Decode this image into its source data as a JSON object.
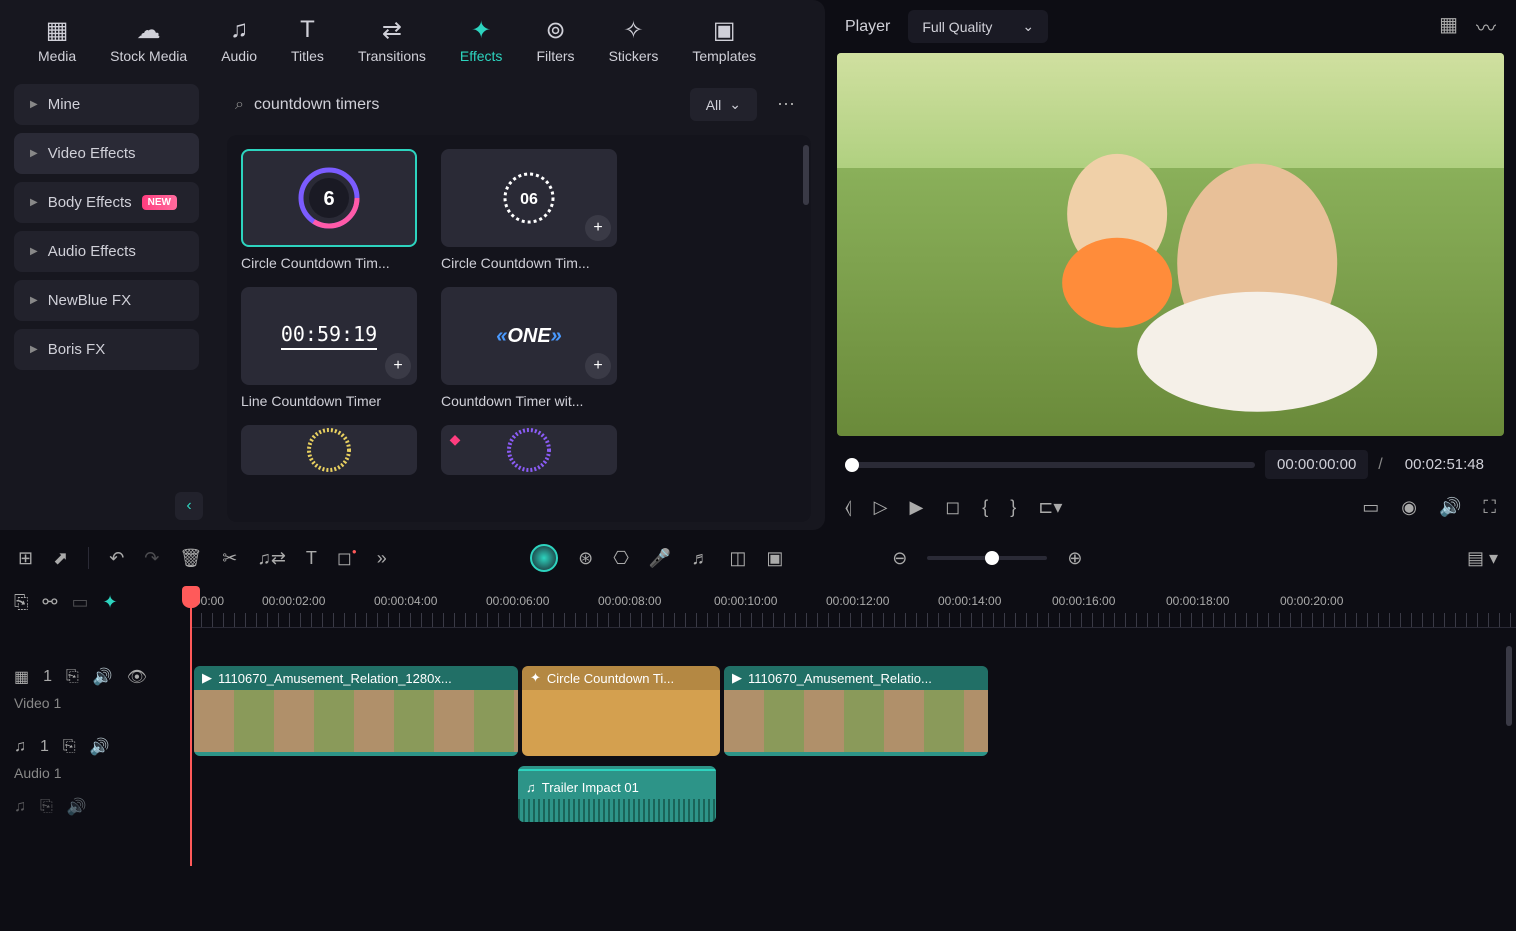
{
  "nav": {
    "tabs": [
      {
        "id": "media",
        "label": "Media"
      },
      {
        "id": "stock",
        "label": "Stock Media"
      },
      {
        "id": "audio",
        "label": "Audio"
      },
      {
        "id": "titles",
        "label": "Titles"
      },
      {
        "id": "transitions",
        "label": "Transitions"
      },
      {
        "id": "effects",
        "label": "Effects"
      },
      {
        "id": "filters",
        "label": "Filters"
      },
      {
        "id": "stickers",
        "label": "Stickers"
      },
      {
        "id": "templates",
        "label": "Templates"
      }
    ],
    "active": "effects"
  },
  "sidebar": {
    "items": [
      {
        "label": "Mine"
      },
      {
        "label": "Video Effects",
        "active": true
      },
      {
        "label": "Body Effects",
        "new": true
      },
      {
        "label": "Audio Effects"
      },
      {
        "label": "NewBlue FX"
      },
      {
        "label": "Boris FX"
      }
    ]
  },
  "search": {
    "value": "countdown timers",
    "filter": "All"
  },
  "effects": [
    {
      "label": "Circle Countdown Tim...",
      "selected": true,
      "number": "6"
    },
    {
      "label": "Circle Countdown Tim...",
      "number": "06"
    },
    {
      "label": "Line Countdown Timer",
      "time": "00:59:19"
    },
    {
      "label": "Countdown Timer wit...",
      "one": "ONE"
    }
  ],
  "player": {
    "title": "Player",
    "quality": "Full Quality",
    "current": "00:00:00:00",
    "duration": "00:02:51:48"
  },
  "ruler": {
    "ticks": [
      "00:00",
      "00:00:02:00",
      "00:00:04:00",
      "00:00:06:00",
      "00:00:08:00",
      "00:00:10:00",
      "00:00:12:00",
      "00:00:14:00",
      "00:00:16:00",
      "00:00:18:00",
      "00:00:20:00"
    ]
  },
  "tracks": {
    "video": {
      "num": "1",
      "label": "Video 1"
    },
    "audio": {
      "num": "1",
      "label": "Audio 1"
    }
  },
  "clips": {
    "v1": "1110670_Amusement_Relation_1280x...",
    "v2": "Circle Countdown Ti...",
    "v3": "1110670_Amusement_Relatio...",
    "a1": "Trailer Impact 01"
  }
}
